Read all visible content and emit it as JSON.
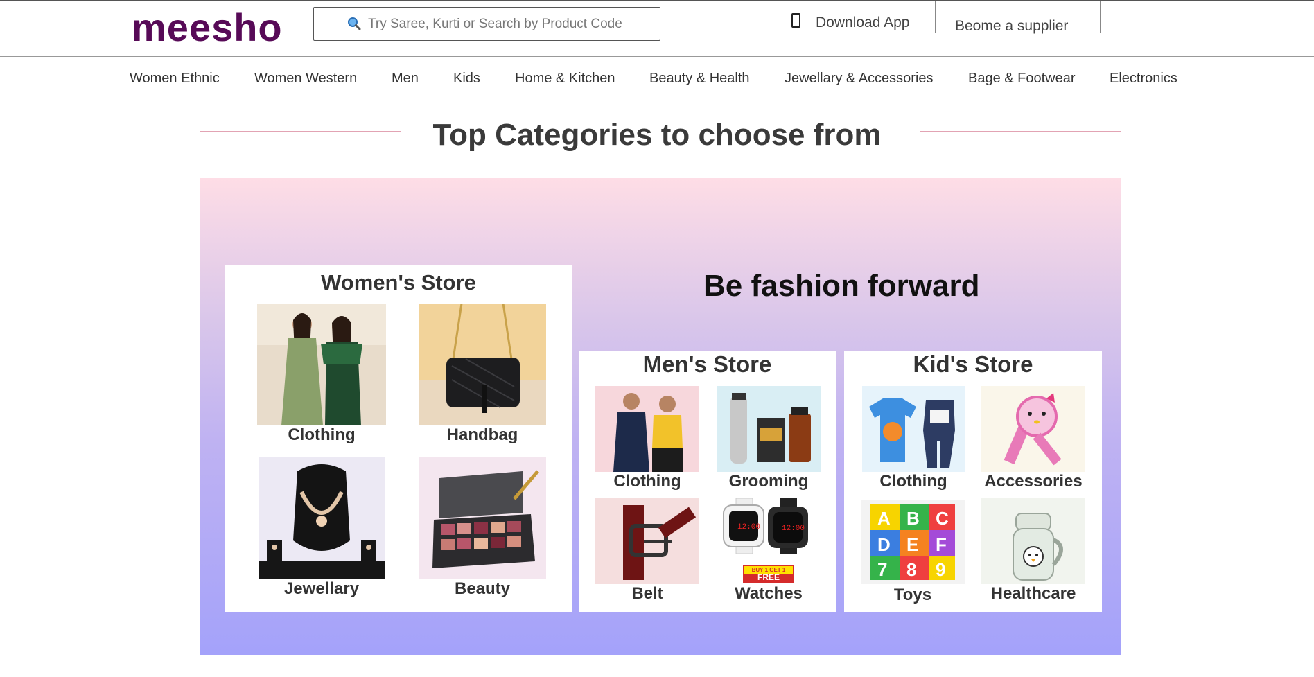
{
  "header": {
    "logo": "meesho",
    "search_placeholder": "Try Saree, Kurti or Search by Product Code",
    "download_app": "Download App",
    "supplier": "Beome a supplier"
  },
  "nav": {
    "items": [
      "Women Ethnic",
      "Women Western",
      "Men",
      "Kids",
      "Home & Kitchen",
      "Beauty & Health",
      "Jewellary & Accessories",
      "Bage & Footwear",
      "Electronics"
    ]
  },
  "main": {
    "title": "Top Categories to choose from",
    "tagline": "Be fashion forward",
    "stores": {
      "women": {
        "title": "Women's Store",
        "tiles": [
          "Clothing",
          "Handbag",
          "Jewellary",
          "Beauty"
        ]
      },
      "men": {
        "title": "Men's Store",
        "tiles": [
          "Clothing",
          "Grooming",
          "Belt",
          "Watches"
        ]
      },
      "kids": {
        "title": "Kid's Store",
        "tiles": [
          "Clothing",
          "Accessories",
          "Toys",
          "Healthcare"
        ]
      }
    },
    "watch_promo": {
      "line1": "BUY 1 GET 1",
      "line2": "FREE"
    }
  },
  "colors": {
    "brand": "#570a57",
    "banner_top": "#fedde6",
    "banner_bottom": "#a4a2fa"
  }
}
